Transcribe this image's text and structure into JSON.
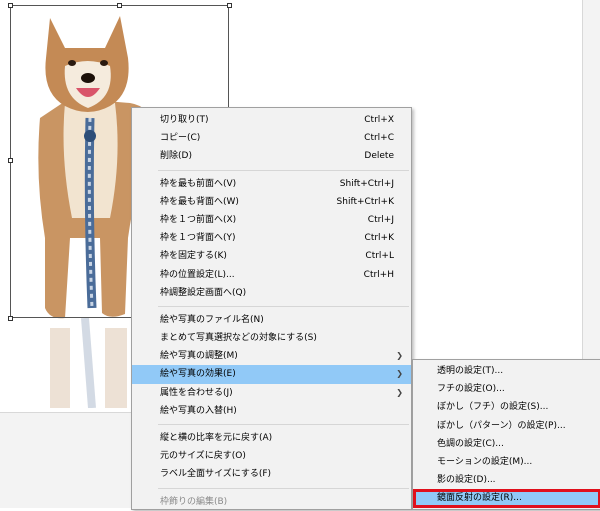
{
  "context_menu": {
    "items": [
      {
        "label": "切り取り(T)",
        "shortcut": "Ctrl+X"
      },
      {
        "label": "コピー(C)",
        "shortcut": "Ctrl+C"
      },
      {
        "label": "削除(D)",
        "shortcut": "Delete"
      },
      {
        "label": "枠を最も前面へ(V)",
        "shortcut": "Shift+Ctrl+J"
      },
      {
        "label": "枠を最も背面へ(W)",
        "shortcut": "Shift+Ctrl+K"
      },
      {
        "label": "枠を１つ前面へ(X)",
        "shortcut": "Ctrl+J"
      },
      {
        "label": "枠を１つ背面へ(Y)",
        "shortcut": "Ctrl+K"
      },
      {
        "label": "枠を固定する(K)",
        "shortcut": "Ctrl+L"
      },
      {
        "label": "枠の位置設定(L)...",
        "shortcut": "Ctrl+H"
      },
      {
        "label": "枠調整設定画面へ(Q)",
        "shortcut": ""
      },
      {
        "label": "絵や写真のファイル名(N)",
        "shortcut": ""
      },
      {
        "label": "まとめて写真選択などの対象にする(S)",
        "shortcut": ""
      },
      {
        "label": "絵や写真の調整(M)",
        "shortcut": ""
      },
      {
        "label": "絵や写真の効果(E)",
        "shortcut": ""
      },
      {
        "label": "属性を合わせる(J)",
        "shortcut": ""
      },
      {
        "label": "絵や写真の入替(H)",
        "shortcut": ""
      },
      {
        "label": "縦と横の比率を元に戻す(A)",
        "shortcut": ""
      },
      {
        "label": "元のサイズに戻す(O)",
        "shortcut": ""
      },
      {
        "label": "ラベル全面サイズにする(F)",
        "shortcut": ""
      },
      {
        "label": "枠飾りの編集(B)",
        "shortcut": ""
      }
    ]
  },
  "submenu": {
    "items": [
      {
        "label": "透明の設定(T)..."
      },
      {
        "label": "フチの設定(O)..."
      },
      {
        "label": "ぼかし（フチ）の設定(S)..."
      },
      {
        "label": "ぼかし（パターン）の設定(P)..."
      },
      {
        "label": "色調の設定(C)..."
      },
      {
        "label": "モーションの設定(M)..."
      },
      {
        "label": "影の設定(D)..."
      },
      {
        "label": "鏡面反射の設定(R)..."
      }
    ]
  },
  "colors": {
    "highlight": "#91c9f7",
    "callout_box": "#e0101c"
  }
}
